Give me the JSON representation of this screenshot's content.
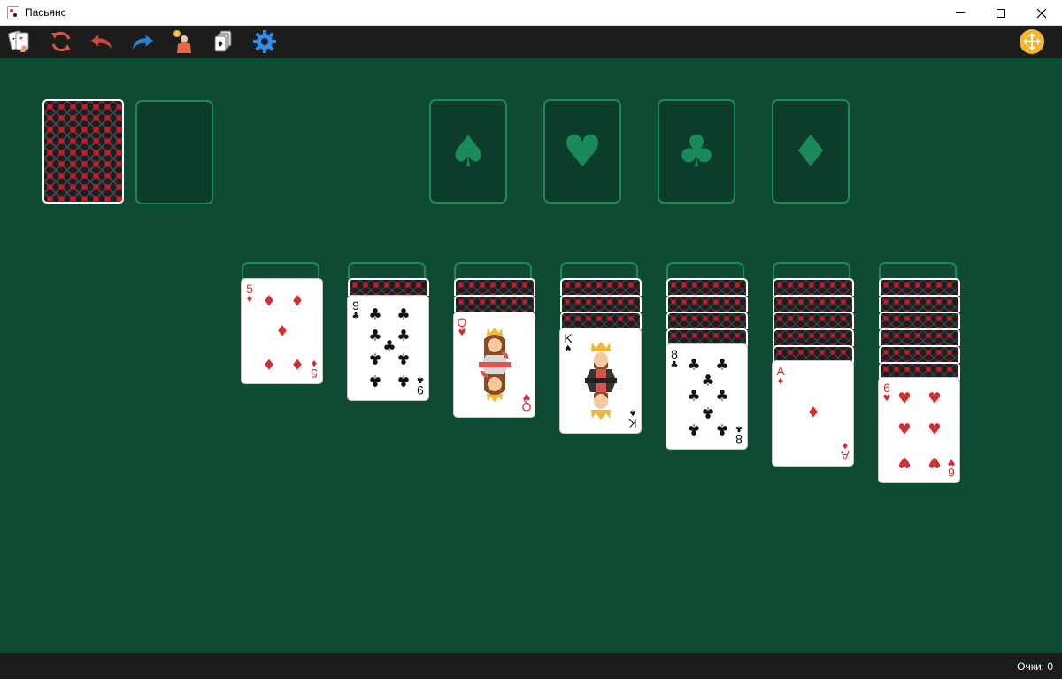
{
  "window": {
    "title": "Пасьянс"
  },
  "toolbar": {
    "buttons": [
      {
        "name": "new-game-button",
        "icon": "cards-hand-icon"
      },
      {
        "name": "restart-button",
        "icon": "refresh-icon"
      },
      {
        "name": "undo-button",
        "icon": "undo-icon"
      },
      {
        "name": "redo-button",
        "icon": "redo-icon"
      },
      {
        "name": "hint-button",
        "icon": "hint-person-icon"
      },
      {
        "name": "deck-button",
        "icon": "deck-icon"
      },
      {
        "name": "settings-button",
        "icon": "gear-icon"
      }
    ],
    "move_button_icon": "move-arrows-icon"
  },
  "status": {
    "score_label": "Очки: 0"
  },
  "foundations": [
    {
      "suit": "♠"
    },
    {
      "suit": "♥"
    },
    {
      "suit": "♣"
    },
    {
      "suit": "♦"
    }
  ],
  "tableau": [
    {
      "hidden": 0,
      "top": {
        "rank": "5",
        "suit": "♦",
        "color": "red"
      }
    },
    {
      "hidden": 1,
      "top": {
        "rank": "9",
        "suit": "♣",
        "color": "black"
      }
    },
    {
      "hidden": 2,
      "top": {
        "rank": "Q",
        "suit": "♥",
        "color": "red"
      }
    },
    {
      "hidden": 3,
      "top": {
        "rank": "K",
        "suit": "♠",
        "color": "black"
      }
    },
    {
      "hidden": 4,
      "top": {
        "rank": "8",
        "suit": "♣",
        "color": "black"
      }
    },
    {
      "hidden": 5,
      "top": {
        "rank": "A",
        "suit": "♦",
        "color": "red"
      }
    },
    {
      "hidden": 6,
      "top": {
        "rank": "6",
        "suit": "♥",
        "color": "red"
      }
    }
  ],
  "colors": {
    "table": "#0f4a33",
    "slot_border": "#1b8a5a",
    "red_suit": "#d32f2f",
    "toolbar": "#1c1c1c"
  }
}
